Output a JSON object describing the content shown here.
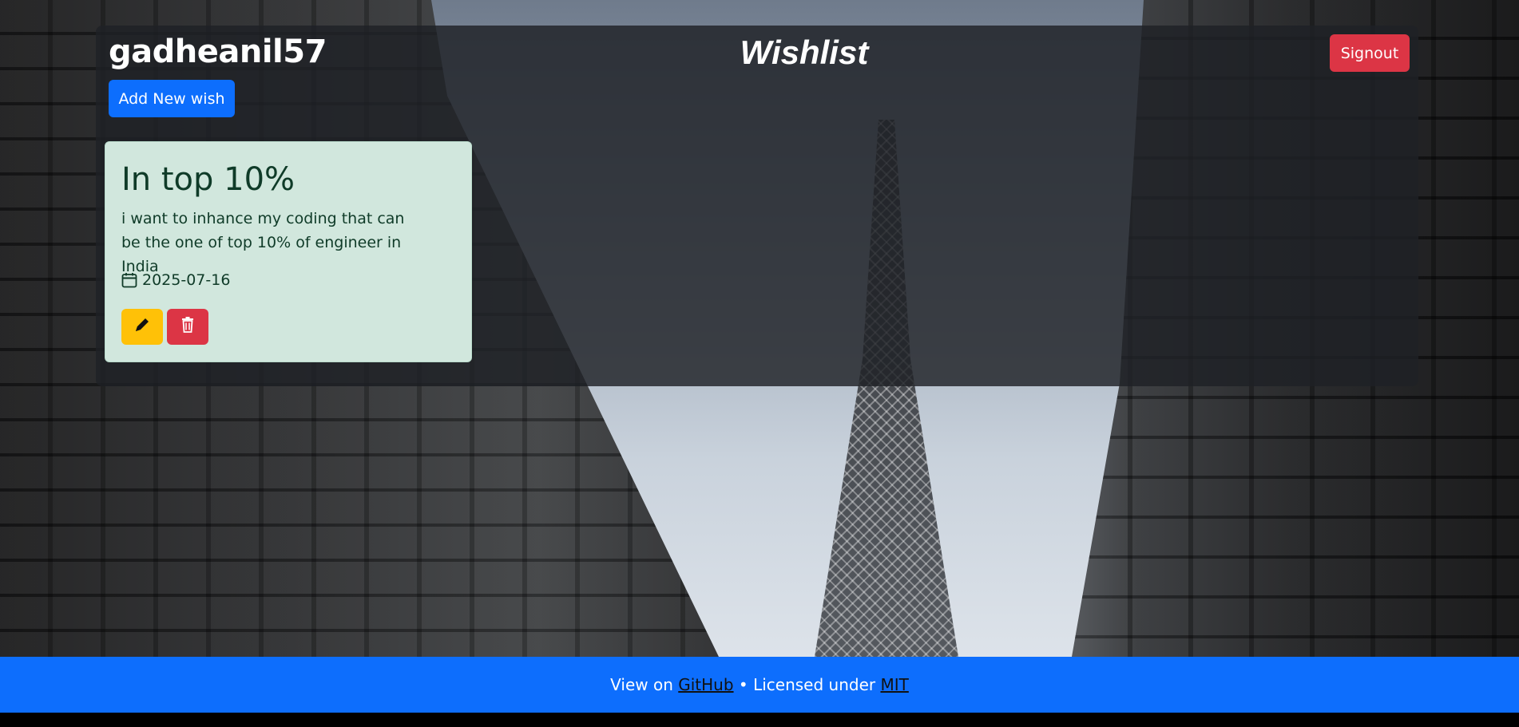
{
  "header": {
    "username": "gadheanil57",
    "app_title": "Wishlist",
    "signout_label": "Signout",
    "add_wish_label": "Add New wish"
  },
  "wishes": [
    {
      "title": "In top 10%",
      "description": "i want to inhance my coding that can be the one of top 10% of engineer in India",
      "date": "2025-07-16",
      "date_icon": "calendar-icon",
      "edit_icon": "pencil-icon",
      "delete_icon": "trash-icon"
    }
  ],
  "footer": {
    "prefix": "View on ",
    "github_link": "GitHub ",
    "separator": " • Licensed under ",
    "license_link": "MIT"
  },
  "colors": {
    "primary": "#0d6efd",
    "danger": "#dc3545",
    "warning": "#ffc107",
    "card_success": "#d1e7dd"
  }
}
